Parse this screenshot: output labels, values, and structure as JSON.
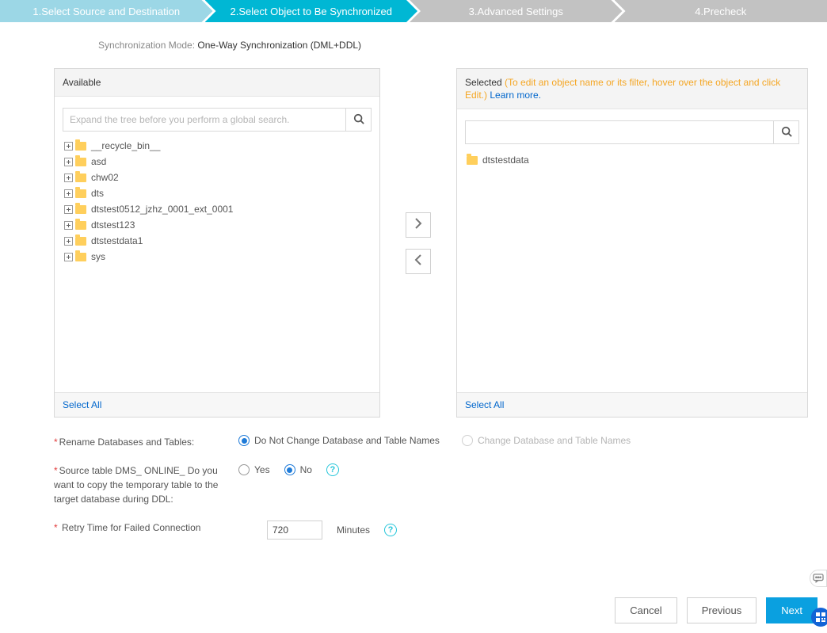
{
  "stepper": {
    "steps": [
      "1.Select Source and Destination",
      "2.Select Object to Be Synchronized",
      "3.Advanced Settings",
      "4.Precheck"
    ]
  },
  "syncMode": {
    "label": "Synchronization Mode:",
    "value": "One-Way Synchronization (DML+DDL)"
  },
  "available": {
    "title": "Available",
    "searchPlaceholder": "Expand the tree before you perform a global search.",
    "items": [
      "__recycle_bin__",
      "asd",
      "chw02",
      "dts",
      "dtstest0512_jzhz_0001_ext_0001",
      "dtstest123",
      "dtstestdata1",
      "sys"
    ],
    "selectAll": "Select All"
  },
  "selected": {
    "title": "Selected",
    "hint": "(To edit an object name or its filter, hover over the object and click Edit.)",
    "learnMore": "Learn more.",
    "items": [
      "dtstestdata"
    ],
    "selectAll": "Select All"
  },
  "options": {
    "rename": {
      "label": "Rename Databases and Tables:",
      "opt1": "Do Not Change Database and Table Names",
      "opt2": "Change Database and Table Names"
    },
    "dmsOnline": {
      "label": "Source table DMS_ ONLINE_ Do you want to copy the temporary table to the target database during DDL:",
      "yes": "Yes",
      "no": "No"
    },
    "retry": {
      "label": "Retry Time for Failed Connection",
      "value": "720",
      "unit": "Minutes"
    }
  },
  "footer": {
    "cancel": "Cancel",
    "previous": "Previous",
    "next": "Next"
  }
}
